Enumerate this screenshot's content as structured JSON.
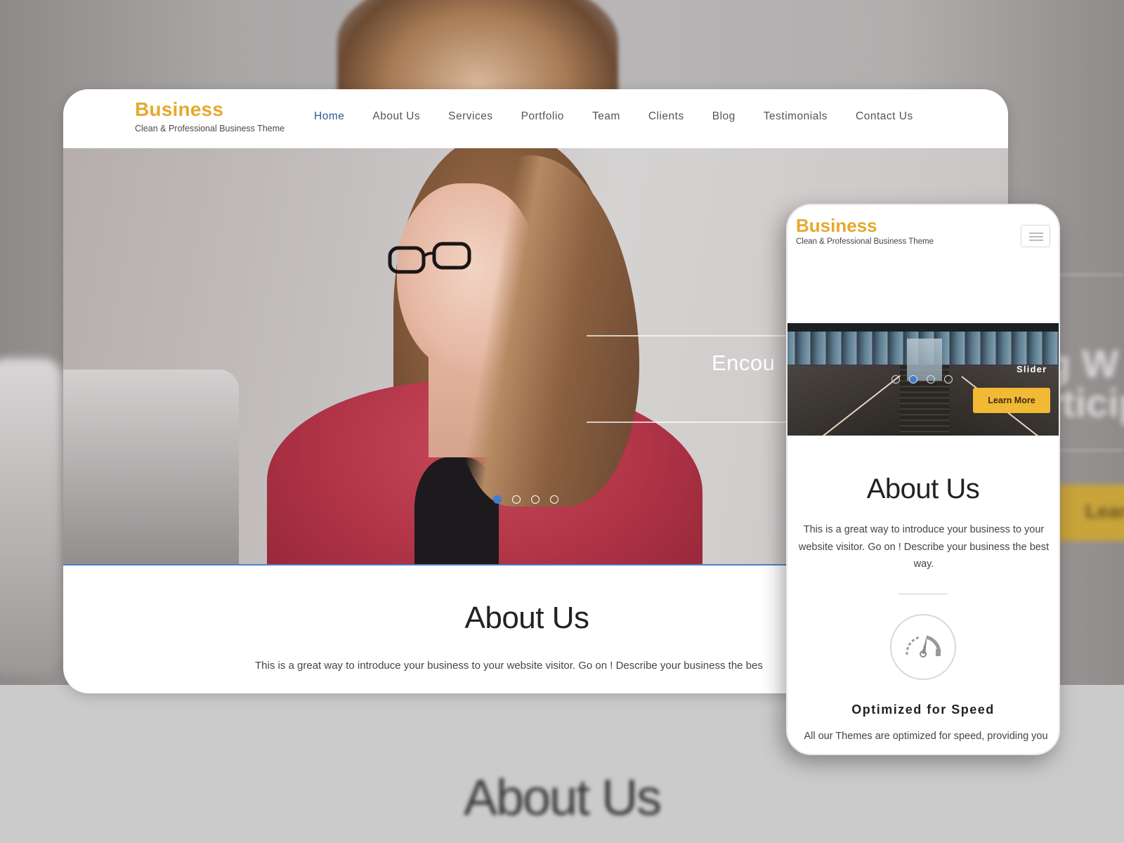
{
  "brand": {
    "title": "Business",
    "tagline": "Clean & Professional Business Theme",
    "accent_color": "#e6a92d"
  },
  "desktop": {
    "nav": [
      {
        "label": "Home",
        "active": true
      },
      {
        "label": "About Us",
        "active": false
      },
      {
        "label": "Services",
        "active": false
      },
      {
        "label": "Portfolio",
        "active": false
      },
      {
        "label": "Team",
        "active": false
      },
      {
        "label": "Clients",
        "active": false
      },
      {
        "label": "Blog",
        "active": false
      },
      {
        "label": "Testimonials",
        "active": false
      },
      {
        "label": "Contact Us",
        "active": false
      }
    ],
    "hero": {
      "slide_text": "Encou",
      "slide_count": 4,
      "active_slide": 1
    },
    "about": {
      "title": "About Us",
      "text": "This is a great way to introduce your business to your website visitor. Go on ! Describe your business the bes"
    }
  },
  "mobile": {
    "menu_icon": "hamburger-icon",
    "slider": {
      "caption": "Slider",
      "button_label": "Learn More",
      "slide_count": 4,
      "active_slide": 2
    },
    "about": {
      "title": "About Us",
      "text": "This is a great way to introduce your business to your website visitor. Go on ! Describe your business the best way."
    },
    "feature": {
      "icon": "speedometer-icon",
      "title": "Optimized for Speed",
      "text": "All our Themes are optimized for speed, providing you"
    }
  },
  "background": {
    "blurred_title": "About Us",
    "blurred_slide_text": "g W\nrticip",
    "blurred_button_label": "Lear"
  },
  "colors": {
    "nav_active": "#2a5d8f",
    "slider_dot_active": "#3f7fd0",
    "button_yellow": "#f2b934"
  }
}
